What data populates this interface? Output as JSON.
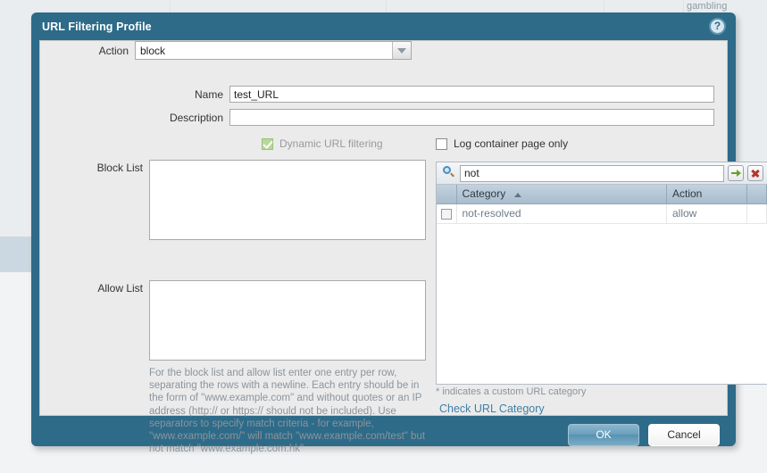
{
  "background": {
    "label_gambling": "gambling"
  },
  "dialog": {
    "title": "URL Filtering Profile",
    "help_icon": "?",
    "fields": {
      "name_label": "Name",
      "name_value": "test_URL",
      "name_placeholder": "",
      "description_label": "Description",
      "description_value": "",
      "description_placeholder": "",
      "dynamic_url_filtering_label": "Dynamic URL filtering",
      "dynamic_url_filtering_checked": true,
      "log_container_label": "Log container page only",
      "log_container_checked": false,
      "block_list_label": "Block List",
      "block_list_value": "",
      "action_label": "Action",
      "action_value": "block",
      "allow_list_label": "Allow List",
      "allow_list_value": ""
    },
    "help_text": "For the block list and allow list enter one entry per row, separating the rows with a newline. Each entry should be in the form of \"www.example.com\" and without quotes or an IP address (http:// or https:// should not be included). Use separators to specify match criteria - for example, \"www.example.com/\" will match \"www.example.com/test\" but not match \"www.example.com.hk\"",
    "category_panel": {
      "search_value": "not",
      "search_placeholder": "",
      "columns": [
        "Category",
        "Action"
      ],
      "sort_column": "Category",
      "sort_direction": "asc",
      "rows": [
        {
          "checked": false,
          "category": "not-resolved",
          "action": "allow"
        }
      ],
      "custom_note": "* indicates a custom URL category",
      "check_url_link": "Check URL Category"
    },
    "footer": {
      "ok_label": "OK",
      "cancel_label": "Cancel"
    }
  }
}
